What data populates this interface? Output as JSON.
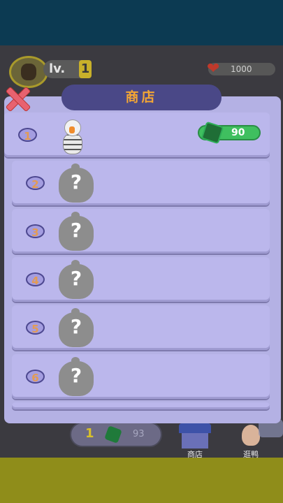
{
  "hud": {
    "level_label": "lv.",
    "level_value": "1",
    "hp_value": "1000"
  },
  "bottom_bar": {
    "count": "1",
    "coins": "93",
    "shop_label": "商店",
    "duck_label": "逛鸭"
  },
  "shop": {
    "title": "商店",
    "items": [
      {
        "index": "1",
        "unlocked": true,
        "price": "90"
      },
      {
        "index": "2",
        "unlocked": false,
        "mystery": "?"
      },
      {
        "index": "3",
        "unlocked": false,
        "mystery": "?"
      },
      {
        "index": "4",
        "unlocked": false,
        "mystery": "?"
      },
      {
        "index": "5",
        "unlocked": false,
        "mystery": "?"
      },
      {
        "index": "6",
        "unlocked": false,
        "mystery": "?"
      }
    ]
  },
  "colors": {
    "panel": "#b4b1e4",
    "title_bar": "#4a4887",
    "title_text": "#f4a634",
    "price_pill": "#3fbf5f",
    "close": "#e8626f"
  },
  "icons": [
    "close-icon",
    "heart-icon",
    "gem-icon",
    "shop-icon",
    "duck-icon",
    "avatar-icon"
  ]
}
